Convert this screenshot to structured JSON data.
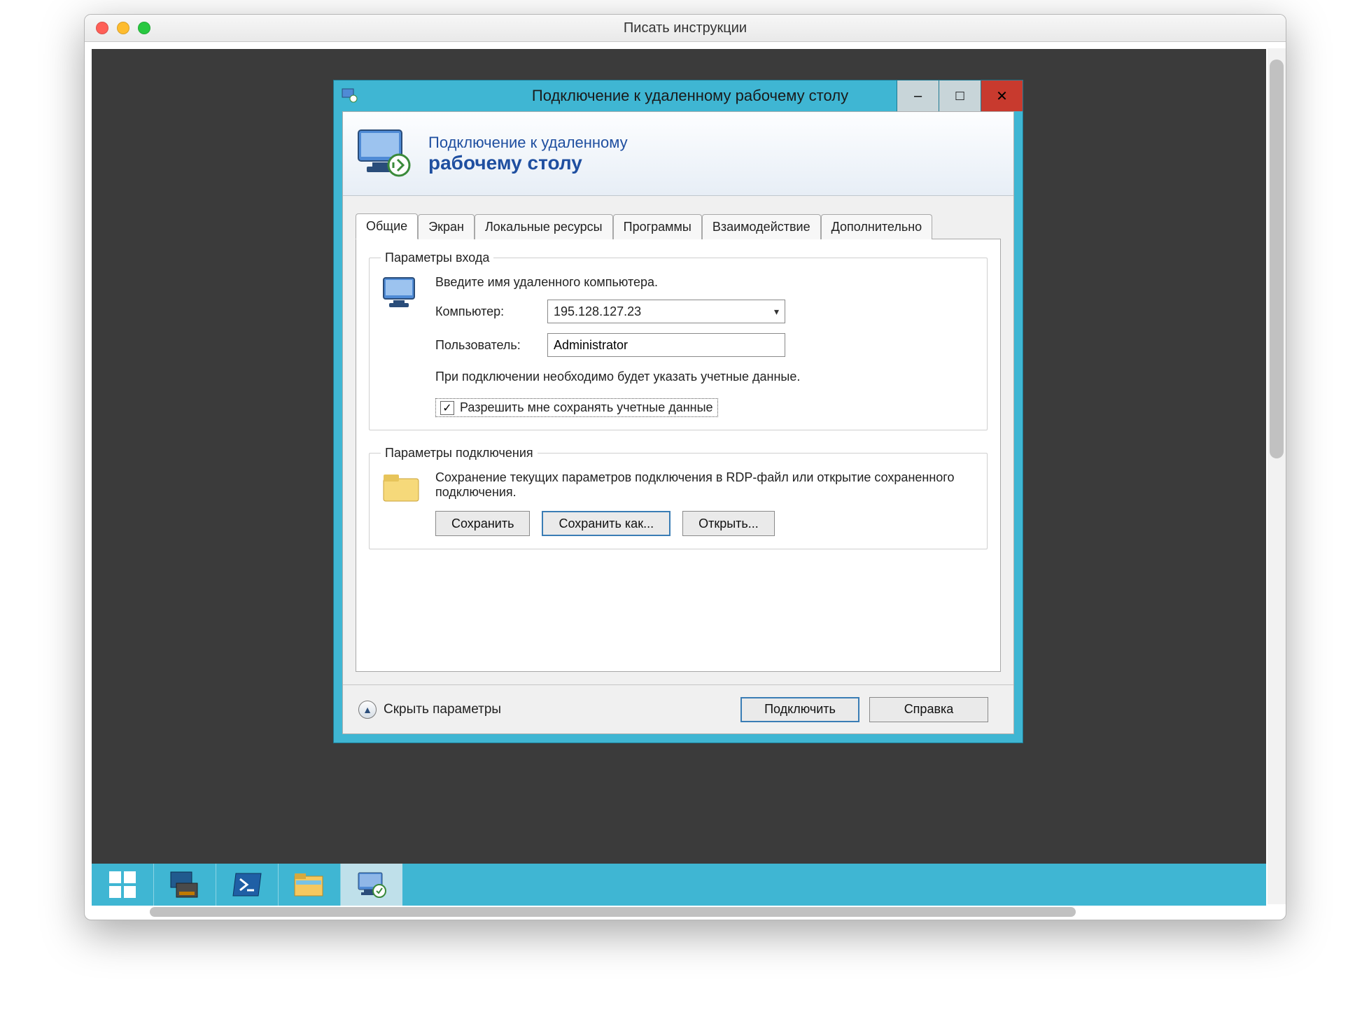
{
  "host_window": {
    "title": "Писать инструкции"
  },
  "rdp": {
    "window_title": "Подключение к удаленному рабочему столу",
    "banner_line1": "Подключение к удаленному",
    "banner_line2": "рабочему столу",
    "tabs": {
      "general": "Общие",
      "display": "Экран",
      "localres": "Локальные ресурсы",
      "programs": "Программы",
      "perf": "Взаимодействие",
      "advanced": "Дополнительно"
    },
    "login_group": {
      "legend": "Параметры входа",
      "intro": "Введите имя удаленного компьютера.",
      "computer_label": "Компьютер:",
      "computer_value": "195.128.127.23",
      "user_label": "Пользователь:",
      "user_value": "Administrator",
      "hint": "При подключении необходимо будет указать учетные данные.",
      "save_creds_label": "Разрешить мне сохранять учетные данные",
      "save_creds_checked": true
    },
    "conn_group": {
      "legend": "Параметры подключения",
      "intro": "Сохранение текущих параметров подключения в RDP-файл или открытие сохраненного подключения.",
      "save_btn": "Сохранить",
      "save_as_btn": "Сохранить как...",
      "open_btn": "Открыть..."
    },
    "footer": {
      "collapse": "Скрыть параметры",
      "connect": "Подключить",
      "help": "Справка"
    },
    "controls": {
      "minimize": "–",
      "maximize": "□",
      "close": "✕"
    }
  },
  "taskbar_items": [
    "start",
    "server-manager",
    "powershell",
    "file-explorer",
    "remote-desktop"
  ]
}
